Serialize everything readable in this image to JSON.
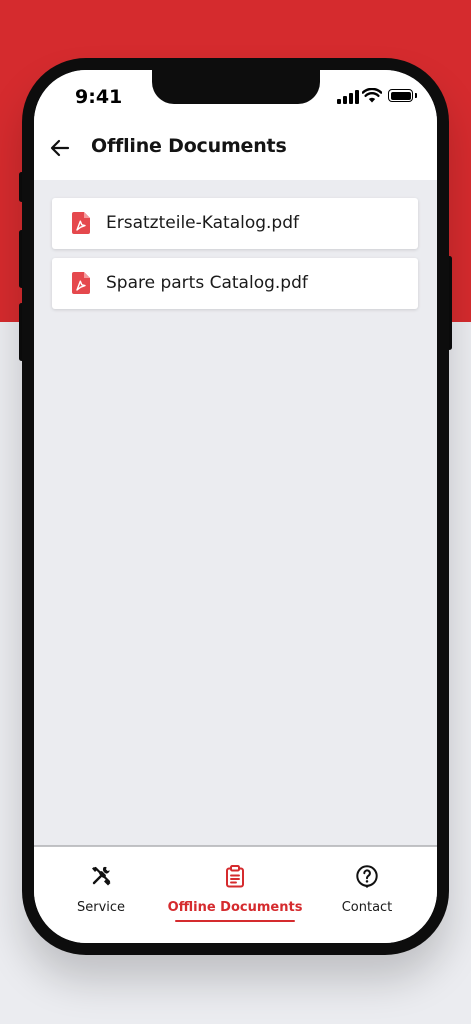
{
  "colors": {
    "brand_red": "#d52b2e",
    "background": "#ebecf0",
    "surface": "#ffffff",
    "text": "#1a1a1a"
  },
  "status_bar": {
    "time": "9:41",
    "icons": [
      "cellular-signal-icon",
      "wifi-icon",
      "battery-icon"
    ]
  },
  "header": {
    "back_icon": "arrow-left-icon",
    "title": "Offline Documents"
  },
  "documents": [
    {
      "icon": "pdf-file-icon",
      "name": "Ersatzteile-Katalog.pdf"
    },
    {
      "icon": "pdf-file-icon",
      "name": "Spare parts Catalog.pdf"
    }
  ],
  "tab_bar": {
    "active": "Offline Documents",
    "tabs": [
      {
        "icon": "tools-icon",
        "label": "Service"
      },
      {
        "icon": "clipboard-list-icon",
        "label": "Offline Documents"
      },
      {
        "icon": "help-bubble-icon",
        "label": "Contact"
      }
    ]
  }
}
